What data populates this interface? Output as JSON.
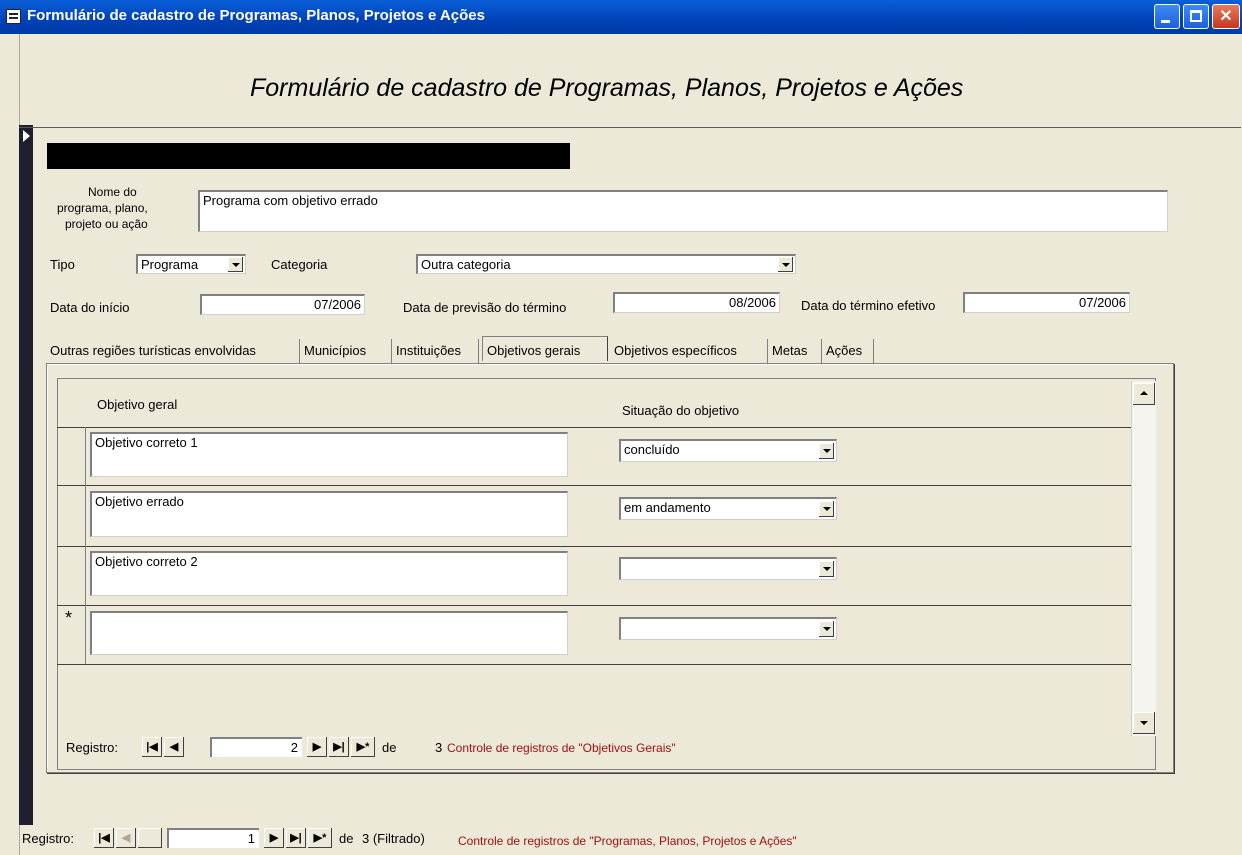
{
  "window": {
    "title": "Formulário de cadastro de Programas, Planos, Projetos e Ações"
  },
  "form": {
    "heading": "Formulário de cadastro de Programas, Planos, Projetos e Ações",
    "nome_label_line1": "Nome do",
    "nome_label_line2": "programa, plano,",
    "nome_label_line3": "projeto ou ação",
    "nome_value": "Programa com objetivo errado",
    "tipo_label": "Tipo",
    "tipo_value": "Programa",
    "categoria_label": "Categoria",
    "categoria_value": "Outra categoria",
    "data_inicio_label": "Data do início",
    "data_inicio_value": "07/2006",
    "data_previsao_label": "Data de previsão do término",
    "data_previsao_value": "08/2006",
    "data_termino_label": "Data do término efetivo",
    "data_termino_value": "07/2006"
  },
  "tabs": [
    {
      "label": "Outras regiões turísticas envolvidas"
    },
    {
      "label": "Municípios"
    },
    {
      "label": "Instituições"
    },
    {
      "label": "Objetivos gerais"
    },
    {
      "label": "Objetivos específicos"
    },
    {
      "label": "Metas"
    },
    {
      "label": "Ações"
    }
  ],
  "subform": {
    "col_objetivo": "Objetivo geral",
    "col_situacao": "Situação do objetivo",
    "rows": [
      {
        "objetivo": "Objetivo correto 1",
        "situacao": "concluído"
      },
      {
        "objetivo": "Objetivo errado",
        "situacao": "em andamento"
      },
      {
        "objetivo": "Objetivo correto 2",
        "situacao": ""
      },
      {
        "objetivo": "",
        "situacao": "",
        "new_marker": "*"
      }
    ],
    "nav": {
      "label": "Registro:",
      "current": "2",
      "of_text": "de",
      "total": "3",
      "status": "Controle de registros de \"Objetivos Gerais\""
    }
  },
  "main_nav": {
    "label": "Registro:",
    "current": "1",
    "of_text": "de",
    "total_text": "3 (Filtrado)",
    "status": "Controle de registros de \"Programas, Planos, Projetos e Ações\""
  },
  "icons": {
    "first": "⏮",
    "prev": "◀",
    "next": "▶",
    "last": "⏭",
    "new": "▶*"
  },
  "colors": {
    "titlebar": "#0a5fd7",
    "form_bg": "#ece9d8",
    "status_red": "#a01010"
  }
}
